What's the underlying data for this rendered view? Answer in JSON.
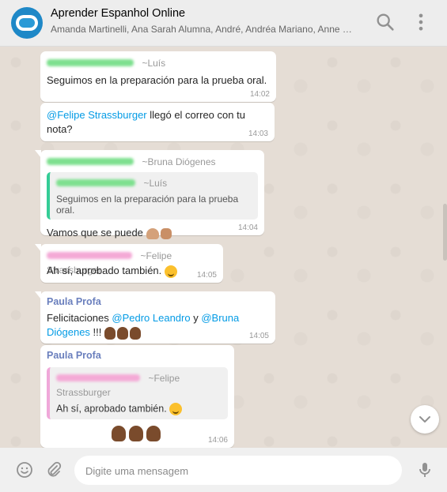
{
  "header": {
    "title": "Aprender Espanhol Online",
    "subtitle": "Amanda Martinelli, Ana Sarah Alumna, André, Andréa Mariano, Anne Me...",
    "icons": [
      "search-icon",
      "menu-icon"
    ]
  },
  "messages": [
    {
      "sender": "~Luís",
      "text": "Seguimos en la preparación para la prueba oral.",
      "time": "14:02"
    },
    {
      "mention": "@Felipe Strassburger",
      "text": " llegó el correo con tu nota?",
      "time": "14:03"
    },
    {
      "sender": "~Bruna Diógenes",
      "quote_sender": "~Luís",
      "quote_text": "Seguimos en la preparación para la prueba oral.",
      "text": "Vamos que se puede",
      "time": "14:04"
    },
    {
      "sender": "~Felipe Strassburger",
      "text": "Ah sí, aprobado también.",
      "time": "14:05"
    },
    {
      "author": "Paula Profa",
      "text_1": "Felicitaciones ",
      "mention_1": "@Pedro Leandro",
      "text_2": " y ",
      "mention_2": "@Bruna Diógenes",
      "text_3": " !!! ",
      "time": "14:05"
    },
    {
      "author": "Paula Profa",
      "quote_sender": "~Felipe Strassburger",
      "quote_text": "Ah sí, aprobado también.",
      "time": "14:06"
    }
  ],
  "composer": {
    "placeholder": "Digite uma mensagem"
  },
  "colors": {
    "accent": "#35cd96",
    "mention": "#039be5",
    "author": "#6a7fbd",
    "background": "#e5ddd5"
  }
}
